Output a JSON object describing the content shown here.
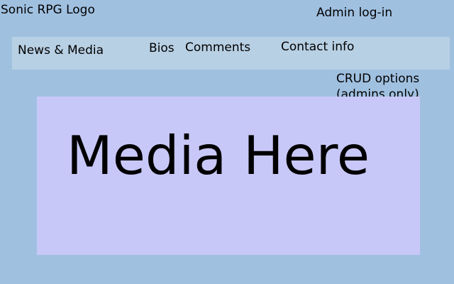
{
  "header": {
    "logo_text": "Sonic RPG Logo",
    "admin_login_label": "Admin log-in"
  },
  "nav": {
    "items": [
      {
        "label": "News & Media"
      },
      {
        "label": "Bios"
      },
      {
        "label": "Comments"
      },
      {
        "label": "Contact info"
      }
    ]
  },
  "crud_note": {
    "line1": "CRUD options",
    "line2": "(admins only)"
  },
  "media": {
    "placeholder_text": "Media Here"
  },
  "colors": {
    "page_background": "#a0c0e0",
    "nav_background": "#b8d0e4",
    "media_background": "#c8c8f8",
    "text": "#000000"
  }
}
